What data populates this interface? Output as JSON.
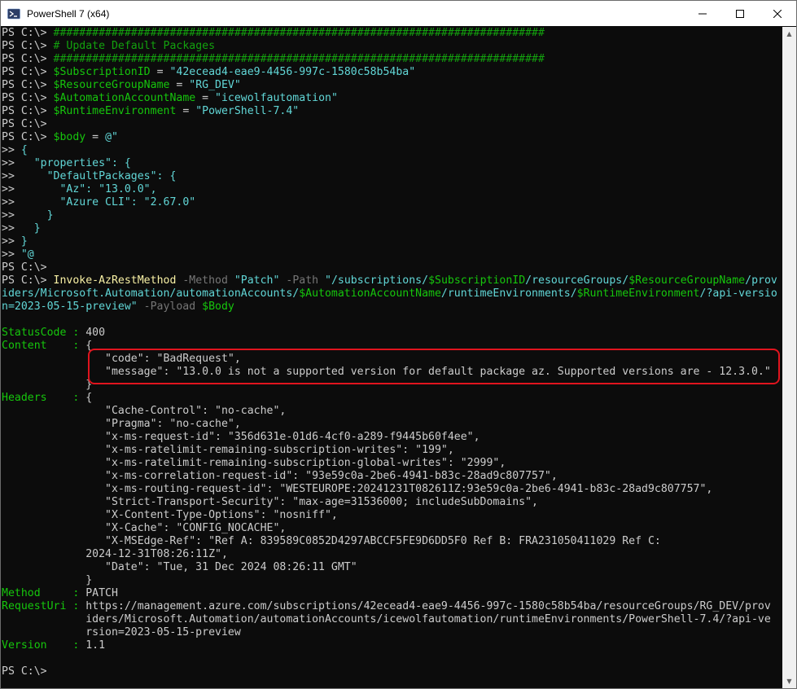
{
  "window": {
    "title": "PowerShell 7 (x64)"
  },
  "prompt": "PS C:\\> ",
  "cont": ">> ",
  "script": {
    "comment_bar": "############################################################################",
    "comment_title": "# Update Default Packages",
    "sub_var": "$SubscriptionID",
    "sub_val": "\"42ecead4-eae9-4456-997c-1580c58b54ba\"",
    "rg_var": "$ResourceGroupName",
    "rg_val": "\"RG_DEV\"",
    "aa_var": "$AutomationAccountName",
    "aa_val": "\"icewolfautomation\"",
    "rt_var": "$RuntimeEnvironment",
    "rt_val": "\"PowerShell-7.4\"",
    "body_var": "$body",
    "eq": " = ",
    "here_open": "@\"",
    "j1": "{",
    "j2": "  \"properties\": {",
    "j3": "    \"DefaultPackages\": {",
    "j4": "      \"Az\": \"13.0.0\",",
    "j5": "      \"Azure CLI\": \"2.67.0\"",
    "j6": "    }",
    "j7": "  }",
    "j8": "}",
    "here_close": "\"@"
  },
  "cmd": {
    "name": "Invoke-AzRestMethod",
    "p_method": " -Method ",
    "method_val": "\"Patch\"",
    "p_path": " -Path ",
    "path_a": "\"/subscriptions/",
    "path_v1": "$SubscriptionID",
    "path_b": "/resourceGroups/",
    "path_v2": "$ResourceGroupName",
    "path_c": "/prov",
    "path_d": "iders/Microsoft.Automation/automationAccounts/",
    "path_v3": "$AutomationAccountName",
    "path_e": "/runtimeEnvironments/",
    "path_v4": "$RuntimeEnvironment",
    "path_f": "/?api-versio",
    "path_g": "n=2023-05-15-preview\"",
    "p_payload": " -Payload ",
    "payload_var": "$Body"
  },
  "output": {
    "status_label": "StatusCode : ",
    "status_val": "400",
    "content_label": "Content    : ",
    "content_open": "{",
    "content_l1": "                \"code\": \"BadRequest\",",
    "content_l2": "                \"message\": \"13.0.0 is not a supported version for default package az. Supported versions are - 12.3.0.\"",
    "content_close": "             }",
    "headers_label": "Headers    : ",
    "headers_open": "{",
    "h1": "                \"Cache-Control\": \"no-cache\",",
    "h2": "                \"Pragma\": \"no-cache\",",
    "h3": "                \"x-ms-request-id\": \"356d631e-01d6-4cf0-a289-f9445b60f4ee\",",
    "h4": "                \"x-ms-ratelimit-remaining-subscription-writes\": \"199\",",
    "h5": "                \"x-ms-ratelimit-remaining-subscription-global-writes\": \"2999\",",
    "h6": "                \"x-ms-correlation-request-id\": \"93e59c0a-2be6-4941-b83c-28ad9c807757\",",
    "h7": "                \"x-ms-routing-request-id\": \"WESTEUROPE:20241231T082611Z:93e59c0a-2be6-4941-b83c-28ad9c807757\",",
    "h8": "                \"Strict-Transport-Security\": \"max-age=31536000; includeSubDomains\",",
    "h9": "                \"X-Content-Type-Options\": \"nosniff\",",
    "h10": "                \"X-Cache\": \"CONFIG_NOCACHE\",",
    "h11": "                \"X-MSEdge-Ref\": \"Ref A: 839589C0852D4297ABCCF5FE9D6DD5F0 Ref B: FRA231050411029 Ref C:",
    "h12": "             2024-12-31T08:26:11Z\",",
    "h13": "                \"Date\": \"Tue, 31 Dec 2024 08:26:11 GMT\"",
    "headers_close": "             }",
    "method_label": "Method     : ",
    "method_val": "PATCH",
    "uri_label": "RequestUri : ",
    "uri_1": "https://management.azure.com/subscriptions/42ecead4-eae9-4456-997c-1580c58b54ba/resourceGroups/RG_DEV/prov",
    "uri_2": "             iders/Microsoft.Automation/automationAccounts/icewolfautomation/runtimeEnvironments/PowerShell-7.4/?api-ve",
    "uri_3": "             rsion=2023-05-15-preview",
    "version_label": "Version    : ",
    "version_val": "1.1"
  },
  "colors": {
    "background": "#0c0c0c",
    "text": "#cccccc",
    "comment": "#13a10e",
    "variable": "#16c60c",
    "string": "#61d6d6",
    "parameter": "#767676",
    "command": "#f9f1a5",
    "highlight": "#e0141e"
  }
}
